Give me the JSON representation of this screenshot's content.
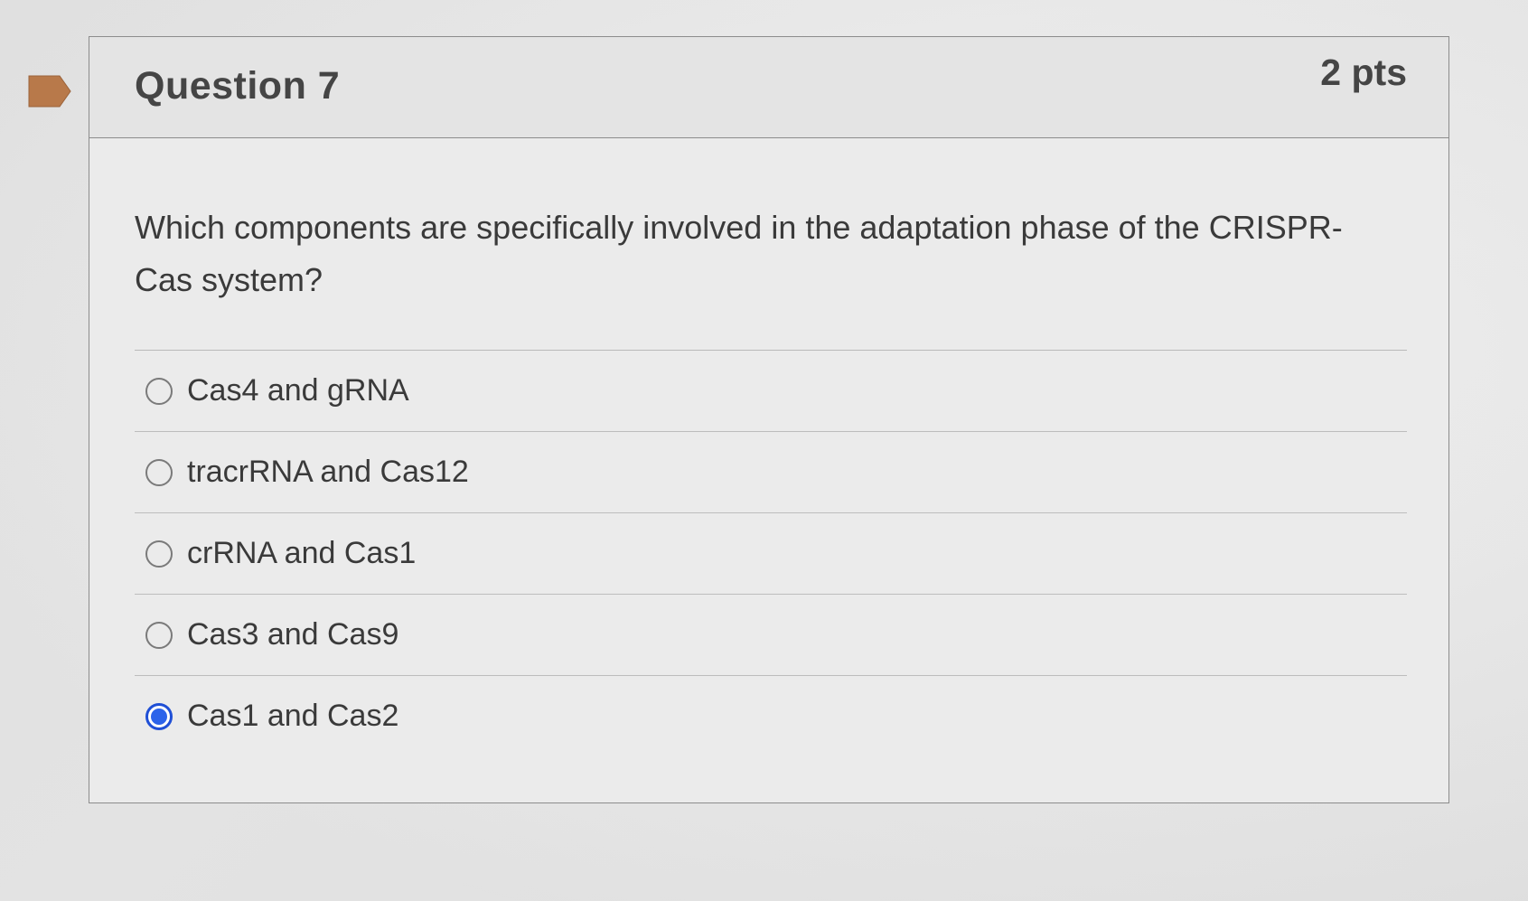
{
  "question": {
    "title": "Question 7",
    "points": "2 pts",
    "text": "Which components are specifically involved in the adaptation phase of the CRISPR-Cas system?",
    "bookmark_icon": "bookmark-flag-icon",
    "bookmark_color": "#b8794a",
    "selected_color": "#2c63ea"
  },
  "answers": [
    {
      "label": "Cas4 and gRNA",
      "selected": false
    },
    {
      "label": "tracrRNA and Cas12",
      "selected": false
    },
    {
      "label": "crRNA and Cas1",
      "selected": false
    },
    {
      "label": "Cas3 and Cas9",
      "selected": false
    },
    {
      "label": "Cas1 and Cas2",
      "selected": true
    }
  ]
}
